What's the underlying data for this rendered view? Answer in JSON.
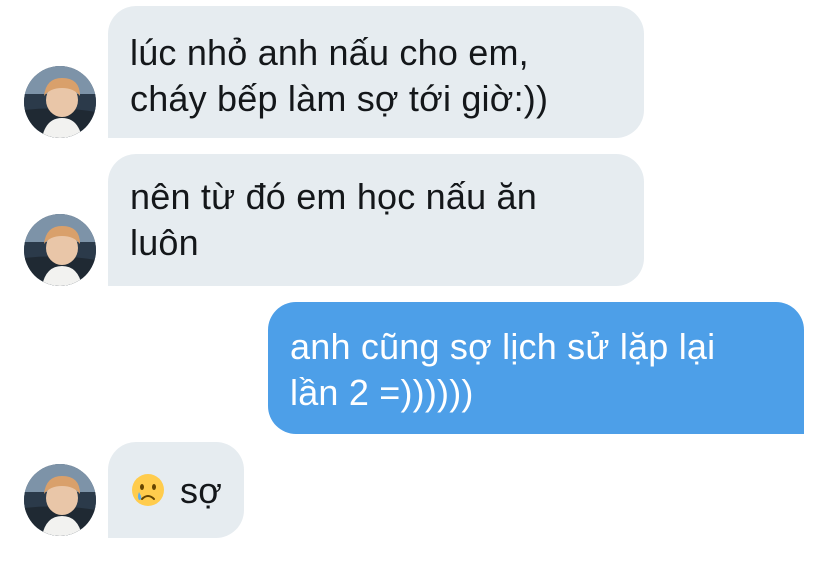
{
  "messages": [
    {
      "direction": "incoming",
      "lines": [
        "lúc nhỏ anh nấu cho em,",
        "cháy bếp làm sợ tới giờ:))"
      ],
      "avatar": "profile-photo"
    },
    {
      "direction": "incoming",
      "lines": [
        "nên từ đó em học nấu ăn",
        "luôn"
      ],
      "avatar": "profile-photo"
    },
    {
      "direction": "outgoing",
      "lines": [
        "anh cũng sợ lịch sử lặp lại",
        "lần 2 =))))))"
      ]
    },
    {
      "direction": "incoming",
      "emoji": "crying-face-emoji",
      "text": "sợ",
      "avatar": "profile-photo"
    }
  ],
  "colors": {
    "incoming_bubble": "#e6ecf0",
    "outgoing_bubble": "#4d9fe8",
    "incoming_text": "#14171a",
    "outgoing_text": "#ffffff"
  }
}
